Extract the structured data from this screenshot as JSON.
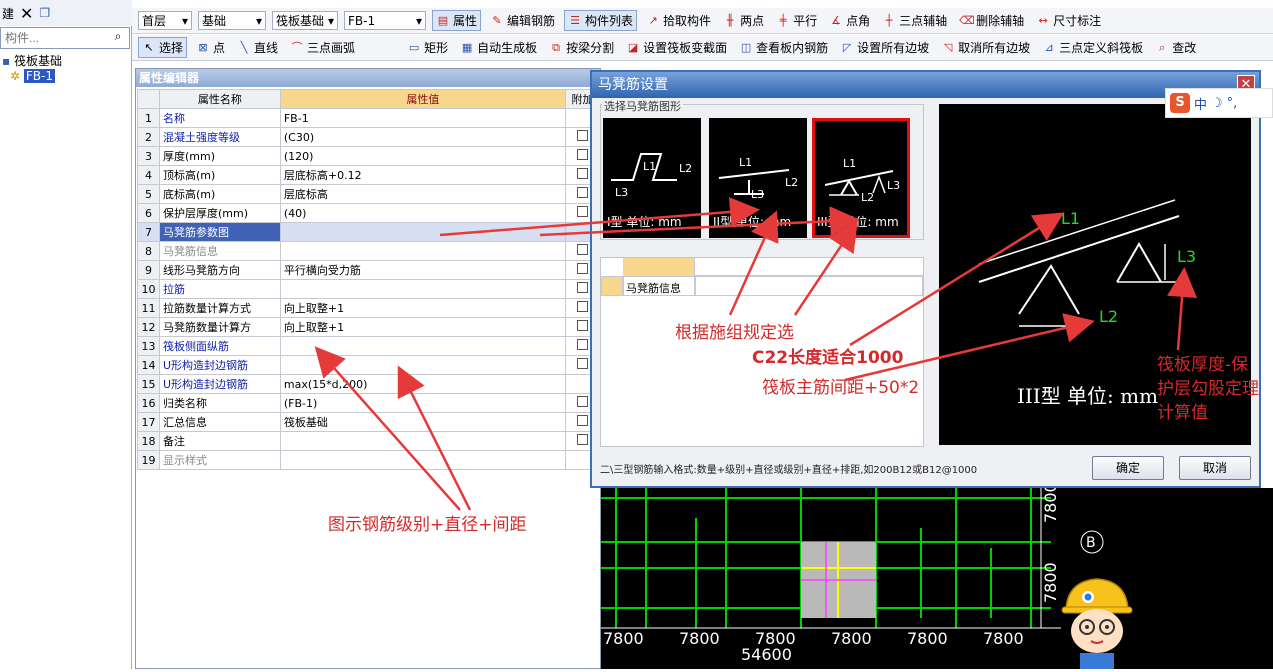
{
  "left_panel": {
    "top_label": "建",
    "search_placeholder": "构件...",
    "tree_root": "筏板基础",
    "tree_child": "FB-1"
  },
  "toolbar1": {
    "floor": "首层",
    "category": "基础",
    "type": "筏板基础",
    "component": "FB-1",
    "attr_btn": "属性",
    "edit_rebar": "编辑钢筋",
    "component_list": "构件列表",
    "pick": "拾取构件",
    "two_points": "两点",
    "parallel": "平行",
    "point_angle": "点角",
    "three_point_axis": "三点辅轴",
    "delete_axis": "删除辅轴",
    "dimension": "尺寸标注"
  },
  "toolbar2": {
    "select": "选择",
    "point": "点",
    "line": "直线",
    "arc": "三点画弧",
    "rect": "矩形",
    "auto_gen": "自动生成板",
    "split_beam": "按梁分割",
    "set_section": "设置筏板变截面",
    "view_rebar": "查看板内钢筋",
    "set_all_slope": "设置所有边坡",
    "cancel_all_slope": "取消所有边坡",
    "three_point_slope": "三点定义斜筏板",
    "check": "查改"
  },
  "props": {
    "title": "属性编辑器",
    "col_name": "属性名称",
    "col_value": "属性值",
    "col_extra": "附加",
    "rows": [
      {
        "n": "1",
        "name": "名称",
        "value": "FB-1",
        "style": "blue",
        "chk": false
      },
      {
        "n": "2",
        "name": "混凝土强度等级",
        "value": "(C30)",
        "style": "blue",
        "chk": true
      },
      {
        "n": "3",
        "name": "厚度(mm)",
        "value": "(120)",
        "style": "",
        "chk": true
      },
      {
        "n": "4",
        "name": "顶标高(m)",
        "value": "层底标高+0.12",
        "style": "",
        "chk": true
      },
      {
        "n": "5",
        "name": "底标高(m)",
        "value": "层底标高",
        "style": "",
        "chk": true
      },
      {
        "n": "6",
        "name": "保护层厚度(mm)",
        "value": "(40)",
        "style": "",
        "chk": true
      },
      {
        "n": "7",
        "name": "马凳筋参数图",
        "value": "",
        "style": "sel",
        "chk": false
      },
      {
        "n": "8",
        "name": "马凳筋信息",
        "value": "",
        "style": "grey",
        "chk": true
      },
      {
        "n": "9",
        "name": "线形马凳筋方向",
        "value": "平行横向受力筋",
        "style": "",
        "chk": true
      },
      {
        "n": "10",
        "name": "拉筋",
        "value": "",
        "style": "blue",
        "chk": true
      },
      {
        "n": "11",
        "name": "拉筋数量计算方式",
        "value": "向上取整+1",
        "style": "",
        "chk": true
      },
      {
        "n": "12",
        "name": "马凳筋数量计算方",
        "value": "向上取整+1",
        "style": "",
        "chk": true
      },
      {
        "n": "13",
        "name": "筏板侧面纵筋",
        "value": "",
        "style": "blue",
        "chk": true
      },
      {
        "n": "14",
        "name": "U形构造封边钢筋",
        "value": "",
        "style": "blue",
        "chk": true
      },
      {
        "n": "15",
        "name": "U形构造封边钢筋",
        "value": "max(15*d,200)",
        "style": "blue",
        "chk": false
      },
      {
        "n": "16",
        "name": "归类名称",
        "value": "(FB-1)",
        "style": "",
        "chk": true
      },
      {
        "n": "17",
        "name": "汇总信息",
        "value": "筏板基础",
        "style": "",
        "chk": true
      },
      {
        "n": "18",
        "name": "备注",
        "value": "",
        "style": "",
        "chk": true
      },
      {
        "n": "19",
        "name": "显示样式",
        "value": "",
        "style": "grey",
        "chk": false
      }
    ]
  },
  "dialog": {
    "title": "马凳筋设置",
    "group_label": "选择马凳筋图形",
    "thumb1_caption": "I型 单位: mm",
    "thumb2_caption": "II型 单位: mm",
    "thumb3_caption": "III型 单位: mm",
    "info_label": "马凳筋信息",
    "preview_caption": "III型 单位: mm",
    "hint": "二\\三型钢筋输入格式:数量+级别+直径或级别+直径+排距,如200B12或B12@1000",
    "ok": "确定",
    "cancel": "取消"
  },
  "cad": {
    "dims": [
      "7800",
      "7800",
      "7800",
      "7800",
      "7800",
      "7800"
    ],
    "total": "54600",
    "axis_b": "B",
    "vertical_dims": [
      "7800",
      "7800"
    ]
  },
  "ime": {
    "text": "中"
  },
  "annotations": {
    "a1": "根据施组规定选",
    "a2": "C22长度适合1000",
    "a3": "筏板主筋间距+50*2",
    "a4_1": "筏板厚度-保",
    "a4_2": "护层勾股定理",
    "a4_3": "计算值",
    "a5": "图示钢筋级别+直径+间距"
  },
  "colors": {
    "accent": "#3c6fb5",
    "annotation": "#d42a2a",
    "cad_green": "#00d000"
  }
}
